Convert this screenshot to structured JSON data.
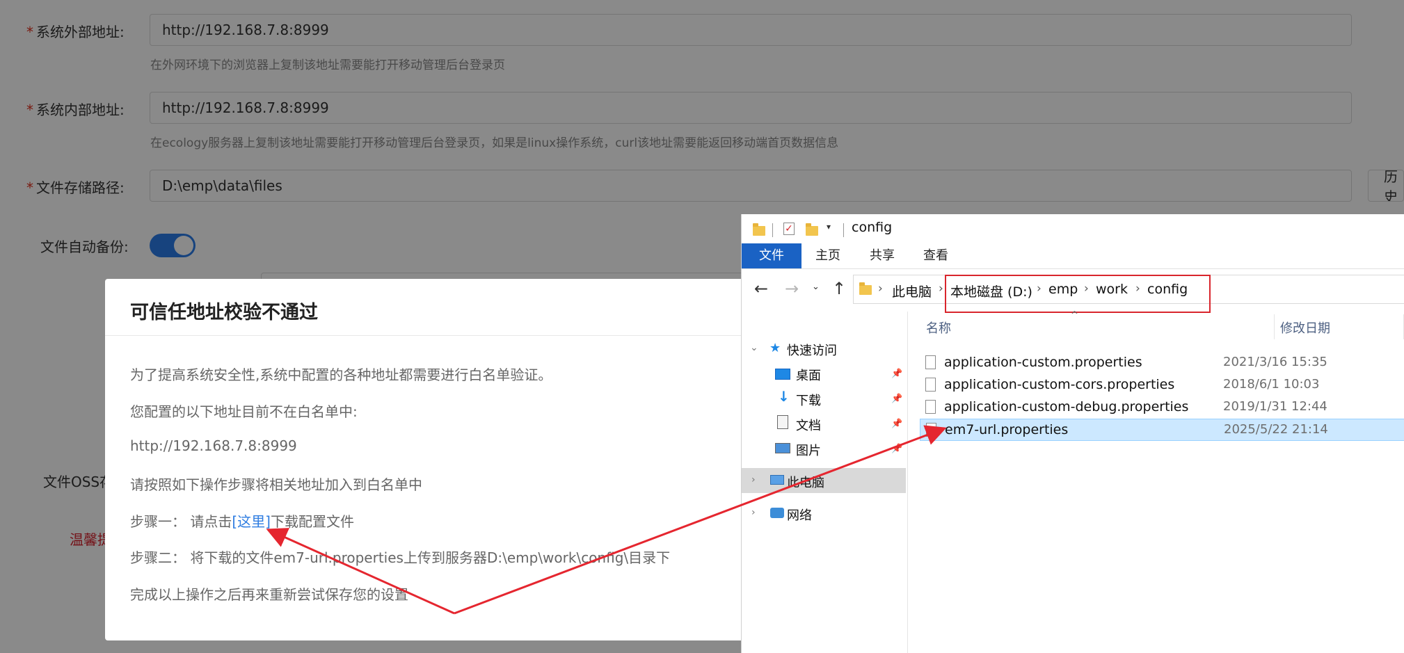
{
  "form": {
    "external_label": "系统外部地址:",
    "external_value": "http://192.168.7.8:8999",
    "external_help": "在外网环境下的浏览器上复制该地址需要能打开移动管理后台登录页",
    "internal_label": "系统内部地址:",
    "internal_value": "http://192.168.7.8:8999",
    "internal_help": "在ecology服务器上复制该地址需要能打开移动管理后台登录页，如果是linux操作系统，curl该地址需要能返回移动端首页数据信息",
    "storage_label": "文件存储路径:",
    "storage_value": "D:\\emp\\data\\files",
    "history_button": "历史",
    "backup_label": "文件自动备份:",
    "oss_label_partial": "文件OSS存",
    "warning_partial": "温馨提"
  },
  "dialog": {
    "title": "可信任地址校验不通过",
    "line1": "为了提高系统安全性,系统中配置的各种地址都需要进行白名单验证。",
    "line2": "您配置的以下地址目前不在白名单中:",
    "address": "http://192.168.7.8:8999",
    "line3": "请按照如下操作步骤将相关地址加入到白名单中",
    "step1_prefix": "步骤一：  请点击",
    "step1_link": "[这里]",
    "step1_suffix": "下载配置文件",
    "step2": "步骤二：  将下载的文件em7-url.properties上传到服务器D:\\emp\\work\\config\\目录下",
    "line4": "完成以上操作之后再来重新尝试保存您的设置"
  },
  "explorer": {
    "window_title": "config",
    "ribbon_tabs": [
      "文件",
      "主页",
      "共享",
      "查看"
    ],
    "breadcrumbs": [
      "此电脑",
      "本地磁盘 (D:)",
      "emp",
      "work",
      "config"
    ],
    "nav": {
      "quick_access": "快速访问",
      "desktop": "桌面",
      "downloads": "下载",
      "documents": "文档",
      "pictures": "图片",
      "this_pc": "此电脑",
      "network": "网络"
    },
    "columns": {
      "name": "名称",
      "date": "修改日期"
    },
    "files": [
      {
        "name": "application-custom.properties",
        "date": "2021/3/16 15:35"
      },
      {
        "name": "application-custom-cors.properties",
        "date": "2018/6/1 10:03"
      },
      {
        "name": "application-custom-debug.properties",
        "date": "2019/1/31 12:44"
      },
      {
        "name": "em7-url.properties",
        "date": "2025/5/22 21:14"
      }
    ]
  },
  "colors": {
    "required_star": "#e0311f",
    "toggle_on": "#2b7de9",
    "link": "#2f7de1",
    "annotation_red": "#e5262f",
    "ribbon_active": "#1a62c4",
    "selected_row": "#cce8ff"
  }
}
